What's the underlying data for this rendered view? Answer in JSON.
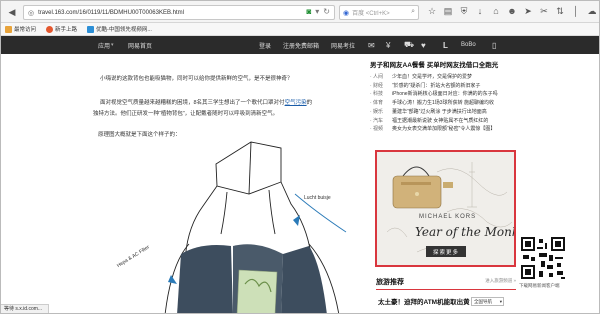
{
  "browser": {
    "url": "travel.163.com/16/0119/11/BDMHU00T00063KEB.html",
    "search_placeholder": "百度 <Ctrl+K>"
  },
  "bookmarks": [
    {
      "label": "最常访问"
    },
    {
      "label": "新手上路"
    },
    {
      "label": "优酷-中国领先视频网..."
    }
  ],
  "sitenav": {
    "left": [
      "应用",
      "网易首页"
    ],
    "right": [
      "登录",
      "注册免费邮箱",
      "网易考拉",
      "BoBo"
    ]
  },
  "article": {
    "p1": "小嗨说的这款背包也能吸猫物，同时可以给你提供新鲜的空气，是不是很神奇？",
    "p2_a": "面对视觉空气质量越来越糟糕的困境，8名其三学生想出了一个歌代口罩对付",
    "p2_link": "空气污染",
    "p2_c": "的",
    "p3": "独特方法。他们正研发一种“植物背包”，让配戴者随时可以呼吸到清新空气。",
    "p4": "原理图大概就是下面这个样子的："
  },
  "illustration": {
    "label_right": "Lucht buisje",
    "label_left": "Hepa & AC Filter"
  },
  "sidebar": {
    "title": "男子和网友AA餐餐  买单时网友找借口全跑光",
    "items": [
      {
        "cat": "· 人间",
        "text": "少年血！交是学坏，交是保护的爱梦"
      },
      {
        "cat": "· 财经",
        "text": "“於感的”疑杀门：折站大名额的新旧家子"
      },
      {
        "cat": "· 科技",
        "text": "iPhone新消耗核心极面日对应：你满的的东子吗"
      },
      {
        "cat": "· 体育",
        "text": "手球心涛！搬力生1场3球所获转 施超聊编均收"
      },
      {
        "cat": "· 娱乐",
        "text": "董建华“部路”过火刷涂  于步满扶行出地面高"
      },
      {
        "cat": "· 汽车",
        "text": "福王据潮最新说驶 女神贴属不在气质红红的"
      },
      {
        "cat": "· 视频",
        "text": "奥女为女表交满单加限额“秘密”令人震惊【图】"
      }
    ]
  },
  "ad": {
    "brand": "MICHAEL KORS",
    "slogan": "Year of the Monkey",
    "button": "探索更多"
  },
  "qr": {
    "caption": "下载网易新闻客户端"
  },
  "travel_section": {
    "title": "旅游推荐",
    "more": "进入旅游频道 »",
    "headline": "太土豪！迪拜的ATM机能取出黄",
    "select": "全国导航"
  },
  "status_bar": {
    "text": "等待 s.x.id.com..."
  },
  "colors": {
    "accent": "#d9363e",
    "nav_bg": "#2b2b2b",
    "link": "#1a5ca8"
  }
}
